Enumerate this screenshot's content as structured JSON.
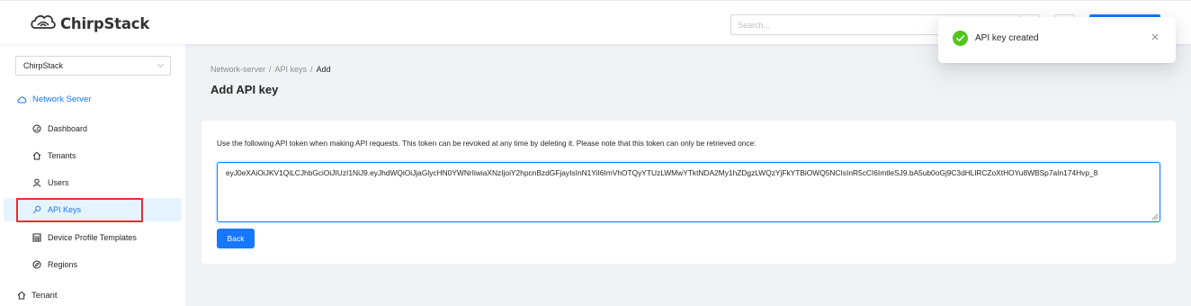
{
  "app": {
    "name": "ChirpStack",
    "logo_icon": "chirpstack-logo"
  },
  "header": {
    "search_placeholder": "Search..."
  },
  "sidebar": {
    "tenant_select": {
      "value": "ChirpStack"
    },
    "network_server": {
      "label": "Network Server",
      "icon": "cloud-icon"
    },
    "items": [
      {
        "label": "Dashboard",
        "icon": "dashboard-icon"
      },
      {
        "label": "Tenants",
        "icon": "home-icon"
      },
      {
        "label": "Users",
        "icon": "user-icon"
      },
      {
        "label": "API Keys",
        "icon": "key-icon",
        "active": true
      },
      {
        "label": "Device Profile Templates",
        "icon": "table-icon"
      },
      {
        "label": "Regions",
        "icon": "compass-icon"
      }
    ],
    "tenant_group": {
      "label": "Tenant",
      "icon": "home-icon"
    }
  },
  "breadcrumb": {
    "items": [
      "Network-server",
      "API keys"
    ],
    "current": "Add"
  },
  "page": {
    "title": "Add API key"
  },
  "card": {
    "instructions": "Use the following API token when making API requests. This token can be revoked at any time by deleting it. Please note that this token can only be retrieved once:",
    "token": "eyJ0eXAiOiJKV1QiLCJhbGciOiJIUzI1NiJ9.eyJhdWQiOiJjaGlycHN0YWNrIiwiaXNzIjoiY2hpcnBzdGFjayIsInN1YiI6ImVhOTQyYTUzLWMwYTktNDA2My1hZDgzLWQzYjFkYTBiOWQ5NCIsInR5cCI6ImtleSJ9.bA5ub0oGj9C3dHLlRCZoXtHOYu8WBSp7aIn174Hvp_8",
    "back_label": "Back"
  },
  "toast": {
    "message": "API key created",
    "status_color": "#52c41a"
  },
  "colors": {
    "primary": "#1677ff",
    "highlight": "#e0312f",
    "success": "#52c41a"
  }
}
